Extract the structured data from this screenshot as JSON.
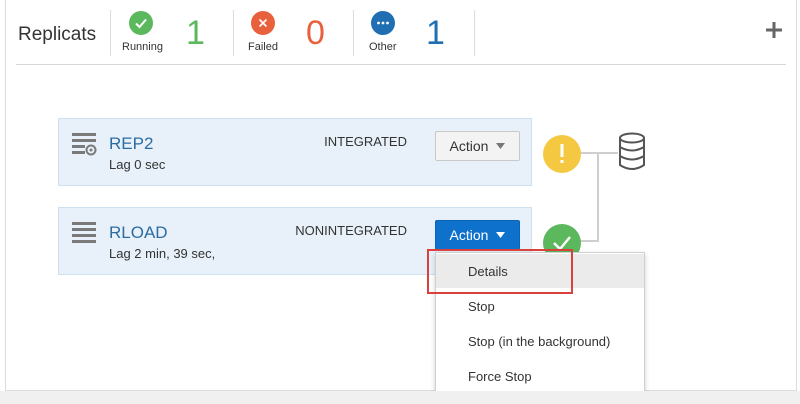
{
  "header": {
    "title": "Replicats",
    "stats": [
      {
        "label": "Running",
        "count": "1",
        "icon": "check-icon",
        "color": "#5cb85c"
      },
      {
        "label": "Failed",
        "count": "0",
        "icon": "close-icon",
        "color": "#e8613c"
      },
      {
        "label": "Other",
        "count": "1",
        "icon": "ellipsis-icon",
        "color": "#1f6fb2"
      }
    ],
    "add_icon": "plus-icon"
  },
  "replicats": [
    {
      "name": "REP2",
      "lag": "Lag 0 sec",
      "mode": "INTEGRATED",
      "action_label": "Action",
      "status": "warning",
      "icon": "integrated-replicat-icon"
    },
    {
      "name": "RLOAD",
      "lag": "Lag 2 min, 39 sec,",
      "mode": "NONINTEGRATED",
      "action_label": "Action",
      "status": "running",
      "icon": "replicat-icon"
    }
  ],
  "database_icon": "database-icon",
  "action_menu": {
    "items": [
      "Details",
      "Stop",
      "Stop (in the background)",
      "Force Stop"
    ],
    "highlighted": "Details"
  },
  "colors": {
    "link": "#2b6ca3",
    "card_bg": "#e8f1f9",
    "action_blue": "#0e72cc",
    "warning": "#f5c842",
    "running": "#5cb85c",
    "annotation_red": "#d9413d"
  }
}
